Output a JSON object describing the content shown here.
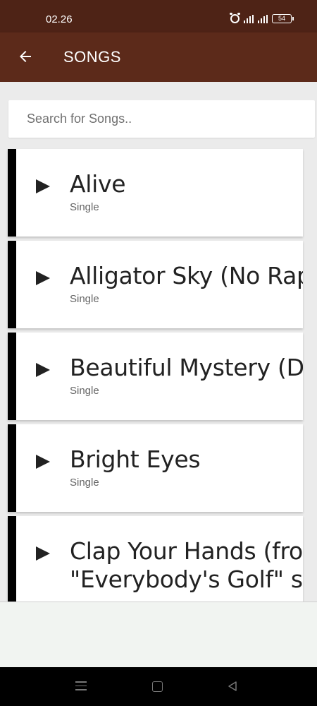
{
  "status": {
    "time": "02.26",
    "battery": "54"
  },
  "app_bar": {
    "title": "SONGS"
  },
  "search": {
    "placeholder": "Search for Songs.."
  },
  "songs": [
    {
      "title": "Alive",
      "subtitle": "Single"
    },
    {
      "title": "Alligator Sky (No Rap Edit)",
      "subtitle": "Single"
    },
    {
      "title": "Beautiful Mystery (Demo)",
      "subtitle": "Single"
    },
    {
      "title": "Bright Eyes",
      "subtitle": "Single"
    },
    {
      "title": "Clap Your Hands (from",
      "title_line2": "\"Everybody's Golf\" soundtrack)"
    }
  ],
  "colors": {
    "status_bar": "#4e2316",
    "app_bar": "#5c2a1a",
    "accent_bar": "#000000"
  },
  "icons": [
    "back-arrow-icon",
    "alarm-icon",
    "signal-icon",
    "battery-icon",
    "play-icon",
    "nav-menu-icon",
    "nav-home-icon",
    "nav-back-icon"
  ]
}
